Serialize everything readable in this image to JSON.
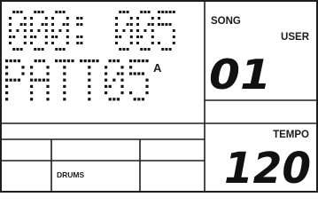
{
  "lcd": {
    "measure_line": "000: 005",
    "pattern_line": "PATT05",
    "pattern_variation": "A",
    "song_label": "SONG",
    "user_label": "USER",
    "song_number": "01",
    "tempo_label": "TEMPO",
    "tempo_value": "120",
    "track_label": "DRUMS",
    "colors": {
      "background": "#ffffff",
      "frame": "#1e1e1e",
      "pixel": "#151515"
    }
  }
}
